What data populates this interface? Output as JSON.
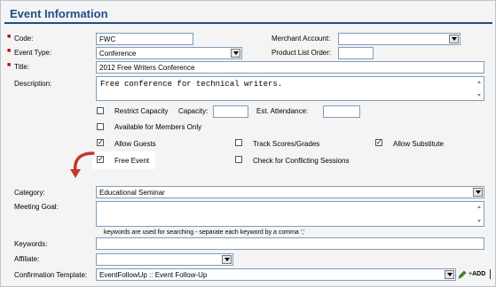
{
  "header": {
    "title": "Event Information"
  },
  "form": {
    "code": {
      "label": "Code:",
      "value": "FWC"
    },
    "merchant_account": {
      "label": "Merchant Account:",
      "value": ""
    },
    "event_type": {
      "label": "Event Type:",
      "value": "Conference"
    },
    "product_list_order": {
      "label": "Product List Order:",
      "value": ""
    },
    "title": {
      "label": "Title:",
      "value": "2012 Free Writers Conference"
    },
    "description": {
      "label": "Description:",
      "value": "Free conference for technical writers."
    },
    "restrict_capacity": {
      "label": "Restrict Capacity",
      "checked": false
    },
    "capacity": {
      "label": "Capacity:",
      "value": ""
    },
    "est_attendance": {
      "label": "Est. Attendance:",
      "value": ""
    },
    "members_only": {
      "label": "Available for Members Only",
      "checked": false
    },
    "allow_guests": {
      "label": "Allow Guests",
      "checked": true
    },
    "track_scores": {
      "label": "Track Scores/Grades",
      "checked": false
    },
    "allow_substitute": {
      "label": "Allow Substitute",
      "checked": true
    },
    "free_event": {
      "label": "Free Event",
      "checked": true
    },
    "conflicting_sessions": {
      "label": "Check for Conflicting Sessions",
      "checked": false
    },
    "category": {
      "label": "Category:",
      "value": "Educational Seminar"
    },
    "meeting_goal": {
      "label": "Meeting Goal:",
      "value": ""
    },
    "keywords_hint": "keywords are used for searching - separate each keyword by a comma ','",
    "keywords": {
      "label": "Keywords:",
      "value": ""
    },
    "affiliate": {
      "label": "Affiliate:",
      "value": ""
    },
    "confirmation_template": {
      "label": "Confirmation Template:",
      "value": "EventFollowUp :: Event Follow-Up",
      "add_label": "ADD"
    }
  },
  "colors": {
    "accent": "#1d4f86",
    "required": "#c00000",
    "arrow": "#c0392b"
  }
}
